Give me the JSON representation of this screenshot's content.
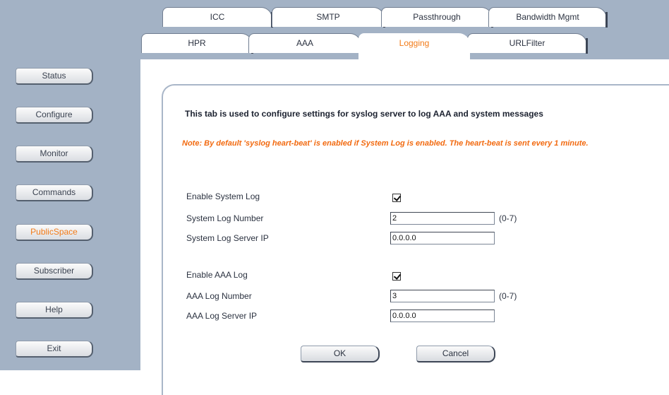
{
  "tabs_row1": [
    "ICC",
    "SMTP",
    "Passthrough",
    "Bandwidth Mgmt"
  ],
  "tabs_row2": [
    "HPR",
    "AAA",
    "Logging",
    "URLFilter"
  ],
  "active_tab": "Logging",
  "sidebar": [
    "Status",
    "Configure",
    "Monitor",
    "Commands",
    "PublicSpace",
    "Subscriber",
    "Help",
    "Exit"
  ],
  "active_sidebar": "PublicSpace",
  "description": "This tab is used to configure settings for syslog server to log AAA and system messages",
  "note": "Note: By default 'syslog heart-beat' is enabled if System Log is enabled. The heart-beat is sent every 1 minute.",
  "form": {
    "enable_system_log": {
      "label": "Enable System Log",
      "checked": true
    },
    "system_log_number": {
      "label": "System Log Number",
      "value": "2",
      "hint": "(0-7)"
    },
    "system_log_server_ip": {
      "label": "System Log Server IP",
      "value": "0.0.0.0"
    },
    "enable_aaa_log": {
      "label": "Enable AAA Log",
      "checked": true
    },
    "aaa_log_number": {
      "label": "AAA Log Number",
      "value": "3",
      "hint": "(0-7)"
    },
    "aaa_log_server_ip": {
      "label": "AAA Log Server IP",
      "value": "0.0.0.0"
    }
  },
  "buttons": {
    "ok": "OK",
    "cancel": "Cancel"
  },
  "colors": {
    "sidebar_bg": "#a3b2c5",
    "accent": "#f27b18",
    "note": "#f26a10"
  }
}
